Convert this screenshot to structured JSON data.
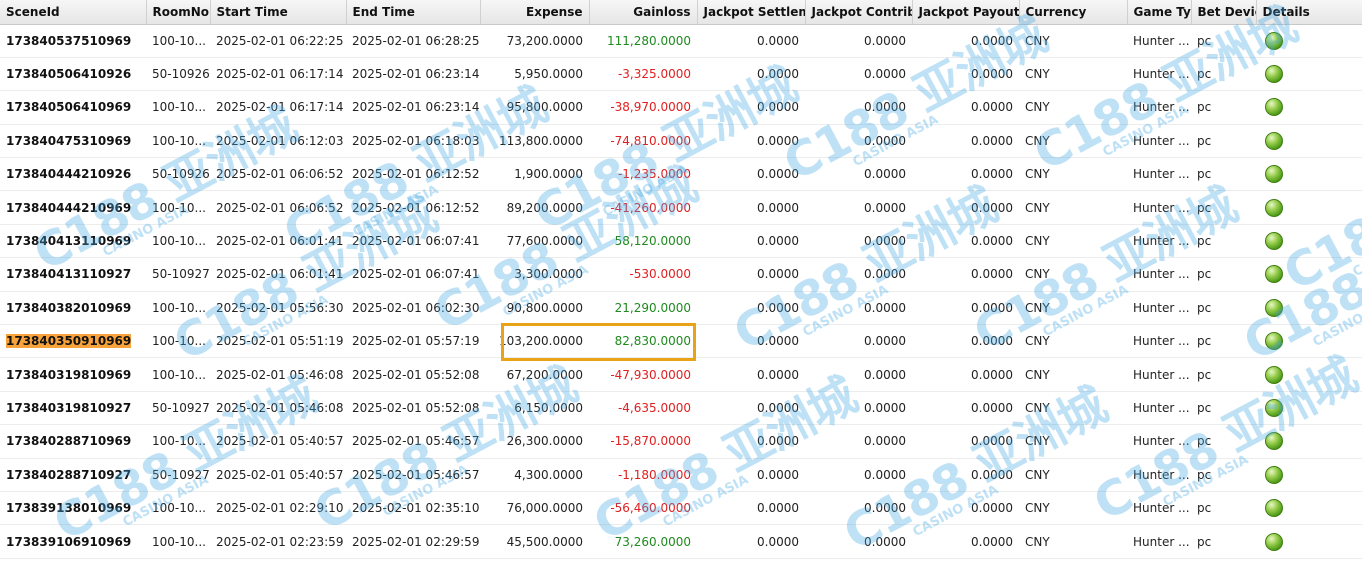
{
  "columns": [
    {
      "label": "SceneId",
      "width": 146,
      "num": false
    },
    {
      "label": "RoomNo...",
      "width": 64,
      "num": false
    },
    {
      "label": "Start Time",
      "width": 136,
      "num": false
    },
    {
      "label": "End Time",
      "width": 134,
      "num": false
    },
    {
      "label": "Expense",
      "width": 109,
      "num": true
    },
    {
      "label": "Gainloss",
      "width": 108,
      "num": true
    },
    {
      "label": "Jackpot Settleme",
      "width": 108,
      "num": true
    },
    {
      "label": "Jackpot Contribu",
      "width": 107,
      "num": true
    },
    {
      "label": "Jackpot Payout",
      "width": 107,
      "num": true
    },
    {
      "label": "Currency",
      "width": 108,
      "num": false
    },
    {
      "label": "Game Typ",
      "width": 64,
      "num": false
    },
    {
      "label": "Bet Devic",
      "width": 65,
      "num": false
    },
    {
      "label": "Details",
      "width": 106,
      "num": false
    }
  ],
  "rows": [
    {
      "scene": "173840537510969",
      "room": "100-10...",
      "start": "2025-02-01 06:22:25",
      "end": "2025-02-01 06:28:25",
      "expense": "73,200.0000",
      "gain": "111,280.0000",
      "sign": "pos",
      "js": "0.0000",
      "jc": "0.0000",
      "jp": "0.0000",
      "cur": "CNY",
      "game": "Hunter ...",
      "dev": "pc"
    },
    {
      "scene": "173840506410926",
      "room": "50-10926",
      "start": "2025-02-01 06:17:14",
      "end": "2025-02-01 06:23:14",
      "expense": "5,950.0000",
      "gain": "-3,325.0000",
      "sign": "neg",
      "js": "0.0000",
      "jc": "0.0000",
      "jp": "0.0000",
      "cur": "CNY",
      "game": "Hunter ...",
      "dev": "pc"
    },
    {
      "scene": "173840506410969",
      "room": "100-10...",
      "start": "2025-02-01 06:17:14",
      "end": "2025-02-01 06:23:14",
      "expense": "95,800.0000",
      "gain": "-38,970.0000",
      "sign": "neg",
      "js": "0.0000",
      "jc": "0.0000",
      "jp": "0.0000",
      "cur": "CNY",
      "game": "Hunter ...",
      "dev": "pc"
    },
    {
      "scene": "173840475310969",
      "room": "100-10...",
      "start": "2025-02-01 06:12:03",
      "end": "2025-02-01 06:18:03",
      "expense": "113,800.0000",
      "gain": "-74,810.0000",
      "sign": "neg",
      "js": "0.0000",
      "jc": "0.0000",
      "jp": "0.0000",
      "cur": "CNY",
      "game": "Hunter ...",
      "dev": "pc"
    },
    {
      "scene": "173840444210926",
      "room": "50-10926",
      "start": "2025-02-01 06:06:52",
      "end": "2025-02-01 06:12:52",
      "expense": "1,900.0000",
      "gain": "-1,235.0000",
      "sign": "neg",
      "js": "0.0000",
      "jc": "0.0000",
      "jp": "0.0000",
      "cur": "CNY",
      "game": "Hunter ...",
      "dev": "pc"
    },
    {
      "scene": "173840444210969",
      "room": "100-10...",
      "start": "2025-02-01 06:06:52",
      "end": "2025-02-01 06:12:52",
      "expense": "89,200.0000",
      "gain": "-41,260.0000",
      "sign": "neg",
      "js": "0.0000",
      "jc": "0.0000",
      "jp": "0.0000",
      "cur": "CNY",
      "game": "Hunter ...",
      "dev": "pc"
    },
    {
      "scene": "173840413110969",
      "room": "100-10...",
      "start": "2025-02-01 06:01:41",
      "end": "2025-02-01 06:07:41",
      "expense": "77,600.0000",
      "gain": "58,120.0000",
      "sign": "pos",
      "js": "0.0000",
      "jc": "0.0000",
      "jp": "0.0000",
      "cur": "CNY",
      "game": "Hunter ...",
      "dev": "pc"
    },
    {
      "scene": "173840413110927",
      "room": "50-10927",
      "start": "2025-02-01 06:01:41",
      "end": "2025-02-01 06:07:41",
      "expense": "3,300.0000",
      "gain": "-530.0000",
      "sign": "neg",
      "js": "0.0000",
      "jc": "0.0000",
      "jp": "0.0000",
      "cur": "CNY",
      "game": "Hunter ...",
      "dev": "pc"
    },
    {
      "scene": "173840382010969",
      "room": "100-10...",
      "start": "2025-02-01 05:56:30",
      "end": "2025-02-01 06:02:30",
      "expense": "90,800.0000",
      "gain": "21,290.0000",
      "sign": "pos",
      "js": "0.0000",
      "jc": "0.0000",
      "jp": "0.0000",
      "cur": "CNY",
      "game": "Hunter ...",
      "dev": "pc"
    },
    {
      "scene": "173840350910969",
      "room": "100-10...",
      "start": "2025-02-01 05:51:19",
      "end": "2025-02-01 05:57:19",
      "expense": "103,200.0000",
      "gain": "82,830.0000",
      "sign": "pos",
      "js": "0.0000",
      "jc": "0.0000",
      "jp": "0.0000",
      "cur": "CNY",
      "game": "Hunter ...",
      "dev": "pc",
      "highlight": true
    },
    {
      "scene": "173840319810969",
      "room": "100-10...",
      "start": "2025-02-01 05:46:08",
      "end": "2025-02-01 05:52:08",
      "expense": "67,200.0000",
      "gain": "-47,930.0000",
      "sign": "neg",
      "js": "0.0000",
      "jc": "0.0000",
      "jp": "0.0000",
      "cur": "CNY",
      "game": "Hunter ...",
      "dev": "pc"
    },
    {
      "scene": "173840319810927",
      "room": "50-10927",
      "start": "2025-02-01 05:46:08",
      "end": "2025-02-01 05:52:08",
      "expense": "6,150.0000",
      "gain": "-4,635.0000",
      "sign": "neg",
      "js": "0.0000",
      "jc": "0.0000",
      "jp": "0.0000",
      "cur": "CNY",
      "game": "Hunter ...",
      "dev": "pc"
    },
    {
      "scene": "173840288710969",
      "room": "100-10...",
      "start": "2025-02-01 05:40:57",
      "end": "2025-02-01 05:46:57",
      "expense": "26,300.0000",
      "gain": "-15,870.0000",
      "sign": "neg",
      "js": "0.0000",
      "jc": "0.0000",
      "jp": "0.0000",
      "cur": "CNY",
      "game": "Hunter ...",
      "dev": "pc"
    },
    {
      "scene": "173840288710927",
      "room": "50-10927",
      "start": "2025-02-01 05:40:57",
      "end": "2025-02-01 05:46:57",
      "expense": "4,300.0000",
      "gain": "-1,180.0000",
      "sign": "neg",
      "js": "0.0000",
      "jc": "0.0000",
      "jp": "0.0000",
      "cur": "CNY",
      "game": "Hunter ...",
      "dev": "pc"
    },
    {
      "scene": "173839138010969",
      "room": "100-10...",
      "start": "2025-02-01 02:29:10",
      "end": "2025-02-01 02:35:10",
      "expense": "76,000.0000",
      "gain": "-56,460.0000",
      "sign": "neg",
      "js": "0.0000",
      "jc": "0.0000",
      "jp": "0.0000",
      "cur": "CNY",
      "game": "Hunter ...",
      "dev": "pc"
    },
    {
      "scene": "173839106910969",
      "room": "100-10...",
      "start": "2025-02-01 02:23:59",
      "end": "2025-02-01 02:29:59",
      "expense": "45,500.0000",
      "gain": "73,260.0000",
      "sign": "pos",
      "js": "0.0000",
      "jc": "0.0000",
      "jp": "0.0000",
      "cur": "CNY",
      "game": "Hunter ...",
      "dev": "pc"
    }
  ],
  "icons": {
    "details": "details-green-ball-icon"
  },
  "colors": {
    "positive": "#1f8a1f",
    "negative": "#e02020",
    "highlight": "#f7a23b",
    "box": "#e8a317",
    "watermark": "#46aae6"
  },
  "watermark": {
    "logo": "C188",
    "cn": "亚洲城",
    "en": "CASINO ASIA"
  }
}
